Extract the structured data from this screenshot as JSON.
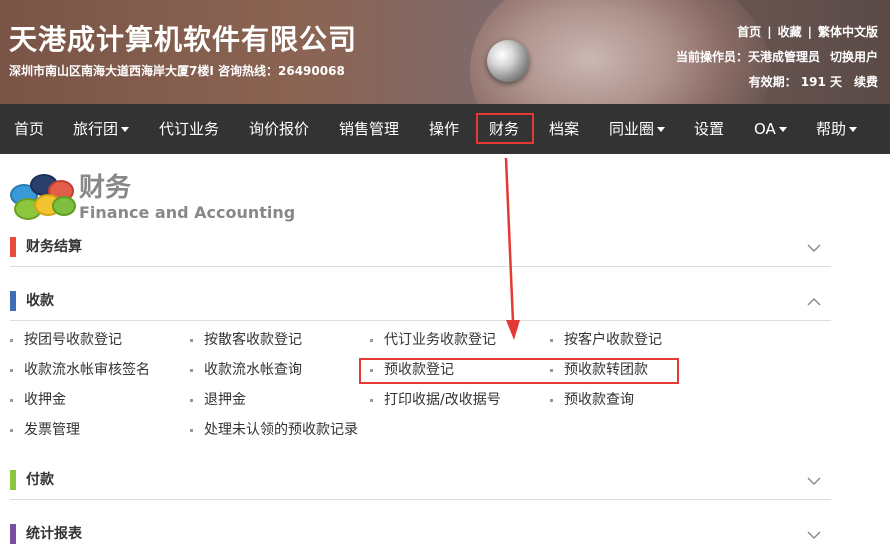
{
  "header": {
    "company_name": "天港成计算机软件有限公司",
    "address_line": "深圳市南山区南海大道西海岸大厦7楼I  咨询热线：26490068",
    "links": [
      "首页",
      "收藏",
      "繁体中文版"
    ],
    "link_separator": "|",
    "current_operator_label": "当前操作员：天港成管理员",
    "switch_user": "切换用户",
    "validity_label": "有效期： 191 天",
    "renew": "续费"
  },
  "nav": {
    "items": [
      {
        "label": "首页",
        "has_caret": false
      },
      {
        "label": "旅行团",
        "has_caret": true
      },
      {
        "label": "代订业务",
        "has_caret": false
      },
      {
        "label": "询价报价",
        "has_caret": false
      },
      {
        "label": "销售管理",
        "has_caret": false
      },
      {
        "label": "操作",
        "has_caret": false
      },
      {
        "label": "财务",
        "has_caret": false,
        "active": true
      },
      {
        "label": "档案",
        "has_caret": false
      },
      {
        "label": "同业圈",
        "has_caret": true
      },
      {
        "label": "设置",
        "has_caret": false
      },
      {
        "label": "OA",
        "has_caret": true
      },
      {
        "label": "帮助",
        "has_caret": true
      }
    ]
  },
  "module": {
    "title": "财务",
    "subtitle": "Finance and Accounting"
  },
  "sections": [
    {
      "label": "财务结算",
      "color": "#e74c3c",
      "expanded": false
    },
    {
      "label": "收款",
      "color": "#3f6db5",
      "expanded": true
    },
    {
      "label": "付款",
      "color": "#8cc63f",
      "expanded": false
    },
    {
      "label": "统计报表",
      "color": "#7b4fa0",
      "expanded": false
    }
  ],
  "collection_links": [
    [
      "按团号收款登记",
      "按散客收款登记",
      "代订业务收款登记",
      "按客户收款登记"
    ],
    [
      "收款流水帐审核签名",
      "收款流水帐查询",
      "预收款登记",
      "预收款转团款"
    ],
    [
      "收押金",
      "退押金",
      "打印收据/改收据号",
      "预收款查询"
    ],
    [
      "发票管理",
      "处理未认领的预收款记录"
    ]
  ],
  "annotation_color": "#e53935"
}
